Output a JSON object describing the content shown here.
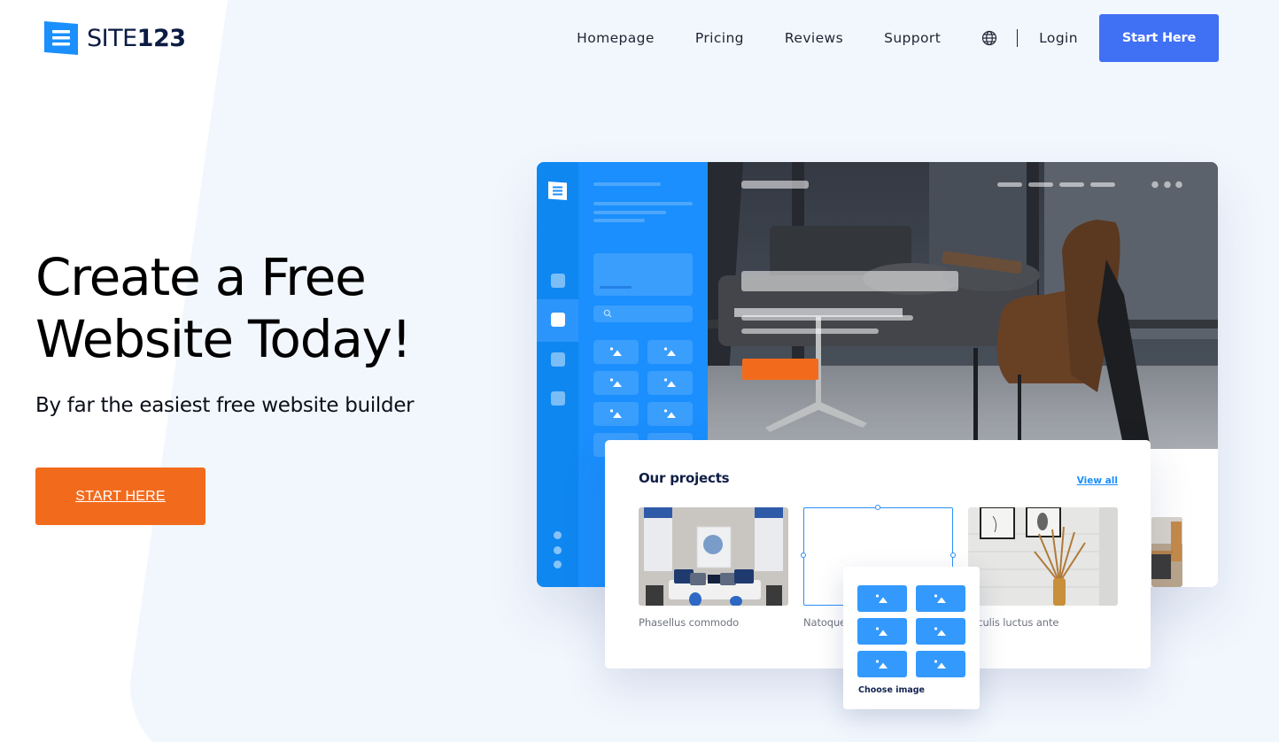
{
  "brand": {
    "name_text": "SITE",
    "name_number": "123",
    "logo_icon": "site123-logo-icon",
    "accent_color": "#1a8ffd",
    "cta_color": "#4070f4",
    "hero_cta_color": "#f26b1d"
  },
  "nav": {
    "items": [
      {
        "label": "Homepage"
      },
      {
        "label": "Pricing"
      },
      {
        "label": "Reviews"
      },
      {
        "label": "Support"
      }
    ],
    "language_icon": "globe-icon",
    "login_label": "Login",
    "cta_label": "Start Here"
  },
  "hero": {
    "title_line1": "Create a Free",
    "title_line2": "Website Today!",
    "subtitle": "By far the easiest free website builder",
    "cta_label": "START HERE"
  },
  "mockup": {
    "editor_rail_icons": [
      "site123-logo-icon",
      "square-icon",
      "square-icon-active",
      "square-icon",
      "square-icon",
      "more-dots-icon"
    ],
    "panel_tile_icon": "image-placeholder-icon",
    "search_icon": "search-icon",
    "projects_card": {
      "title": "Our projects",
      "view_all_label": "View all",
      "projects": [
        {
          "label": "Phasellus commodo"
        },
        {
          "label": "Natoque"
        },
        {
          "label": "Iaculis luctus ante"
        }
      ]
    },
    "image_chooser": {
      "label": "Choose image",
      "tile_count": 6,
      "tile_icon": "image-placeholder-icon"
    }
  }
}
